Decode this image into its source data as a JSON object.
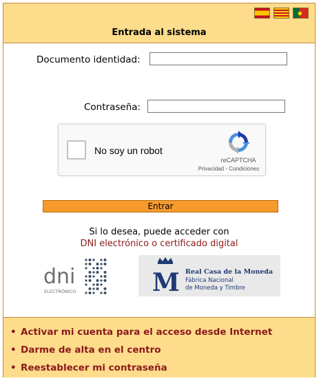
{
  "header": {
    "title": "Entrada al sistema",
    "flags": [
      {
        "name": "spanish-flag-icon",
        "lang": "es"
      },
      {
        "name": "catalan-flag-icon",
        "lang": "ca"
      },
      {
        "name": "portuguese-flag-icon",
        "lang": "pt"
      }
    ]
  },
  "form": {
    "document_label": "Documento identidad:",
    "document_value": "",
    "password_label": "Contraseña:",
    "password_value": "",
    "submit_label": "Entrar"
  },
  "captcha": {
    "label": "No soy un robot",
    "brand": "reCAPTCHA",
    "privacy_link": "Privacidad",
    "separator": " - ",
    "terms_link": "Condiciones",
    "logo_icon": "recaptcha-icon"
  },
  "alternative": {
    "line1": "Si lo desea, puede acceder con",
    "line2": "DNI electrónico o certificado digital"
  },
  "logos": {
    "dni_text": "dni",
    "dni_subtext": "ELECTRÓNICO",
    "fnmt_line1": "Real Casa de la Moneda",
    "fnmt_line2": "Fábrica Nacional",
    "fnmt_line3": "de Moneda y Timbre",
    "fnmt_letter": "M"
  },
  "footer": {
    "links": [
      "Activar mi cuenta para el acceso desde Internet",
      "Darme de alta en el centro",
      "Reestablecer mi contraseña"
    ],
    "bullet": "•"
  },
  "colors": {
    "header_bg": "#fddc8c",
    "border": "#c28a3c",
    "accent_button": "#f79b2d",
    "link": "#8b1a1a"
  }
}
